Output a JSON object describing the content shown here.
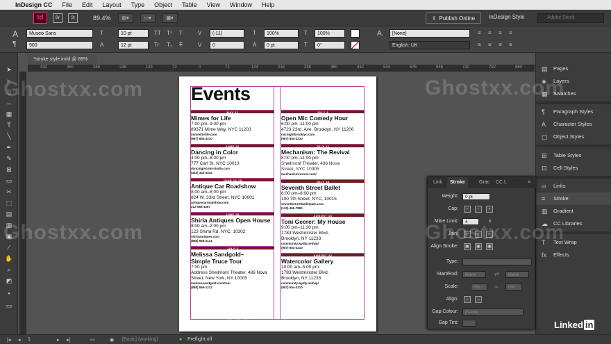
{
  "menubar": {
    "app": "InDesign CC",
    "items": [
      "File",
      "Edit",
      "Layout",
      "Type",
      "Object",
      "Table",
      "View",
      "Window",
      "Help"
    ]
  },
  "appbar": {
    "logo": "Id",
    "bridge": "Br",
    "stock_icon": "St",
    "zoom": "89.4%",
    "publish": "Publish Online",
    "workspace": "InDesign Style",
    "search_placeholder": "Adobe Stock"
  },
  "control": {
    "font_family": "Museo Sans",
    "font_style": "900",
    "font_size": "10 pt",
    "leading": "12 pt",
    "kerning": "(-11)",
    "tracking": "0",
    "vscale": "100%",
    "hscale": "100%",
    "baseline": "0 pt",
    "skew": "0°",
    "char_style": "[None]",
    "language": "English: UK",
    "t_caps": "TT",
    "t_small": "Tr",
    "t_super": "T¹",
    "t_sub": "T₁",
    "t_under": "T",
    "t_strike": "T"
  },
  "doc": {
    "tab": "*stroke style.indd @ 89%"
  },
  "ruler": [
    "432",
    "360",
    "288",
    "216",
    "144",
    "72",
    "0",
    "72",
    "144",
    "216",
    "288",
    "360",
    "432",
    "504",
    "576",
    "648",
    "720",
    "792",
    "864"
  ],
  "page": {
    "title": "Events",
    "left": [
      {
        "date": "MAY 31",
        "title": "Mimes for Life",
        "time": "7:00 pm–9:00 pm",
        "addr": "89371 Mime Way, NYC 11203",
        "url": "mimesforlife.com",
        "phone": "(987) 654-3210"
      },
      {
        "date": "JUNE 20",
        "title": "Dancing in Color",
        "time": "4:00 pm–6:00 pm",
        "addr": "777 Carl St. NYC 10013",
        "url": "dancingincolorstudio.com",
        "phone": "(444) 444-4444"
      },
      {
        "date": "JUNE 24-25",
        "title": "Antique Car Roadshow",
        "time": "8:00 am–6:00 pm",
        "addr": "824 W. 33rd Street, NYC 10001",
        "url": "antiquecarroadshow.com",
        "phone": "212-555-4367"
      },
      {
        "date": "JUNE 28",
        "title": "Shirla Antiques Open House",
        "time": "8:00 am–2:00 pm",
        "addr": "123 Shirla Rd. NYC, 10302",
        "url": "shirlaantiques.com",
        "phone": "(888) 555-2121"
      },
      {
        "date": "JULY 3",
        "title": "Melissa Sandgold–",
        "title2": "Simple Truce Tour",
        "time": "7:00 pm",
        "addr": "Address Shellmont Theater, 486 Nova",
        "addr2": "Street, New York, NY 10005",
        "url": "melissasandgold.com/tour",
        "phone": "(888) 555-1212"
      }
    ],
    "right": [
      {
        "date": "JULY 8",
        "title": "Open Mic Comedy Hour",
        "time": "6:00 pm–11:00 pm",
        "addr": "4723 23rd. Ave, Brooklyn, NY 11206",
        "url": "micnightbrooklyn.com",
        "phone": "(987) 654-3210"
      },
      {
        "date": "JULY 12",
        "title": "Mechanism: The Revival",
        "time": "8:00 pm–11:00 pm",
        "addr": "Shellmont Theater, 486 Nova",
        "addr2": "Street, NYC 10005",
        "url": "mechanismrevival.com/",
        "phone": ""
      },
      {
        "date": "JULY 18",
        "title": "Seventh Street Ballet",
        "time": "6:00 pm–8:00 pm",
        "addr": "100 7th Street, NYC, 10015",
        "url": "seventhstreetballetpark.com",
        "phone": "(123) 456-7890"
      },
      {
        "date": "AUGUST 16",
        "title": "Toni Geerer: My House",
        "time": "9:00 pm–11:30 pm",
        "addr": "1783 Westminster Blvd,",
        "addr2": "Brooklyn, NY 11233",
        "url": "community.wydly.net/wp/",
        "phone": "(987) 654-3210"
      },
      {
        "date": "AUGUST 22",
        "title": "Watercolor Gallery",
        "time": "10:00 am–5:00 pm",
        "addr": "1783 Westminster Blvd,",
        "addr2": "Brooklyn, NY 11233",
        "url": "community.wydly.net/wp/",
        "phone": "(987) 654-3210"
      }
    ]
  },
  "dock": [
    {
      "icon": "▤",
      "label": "Pages"
    },
    {
      "icon": "◈",
      "label": "Layers"
    },
    {
      "icon": "▦",
      "label": "Swatches"
    },
    {
      "icon": "¶",
      "label": "Paragraph Styles"
    },
    {
      "icon": "A",
      "label": "Character Styles"
    },
    {
      "icon": "▢",
      "label": "Object Styles"
    },
    {
      "icon": "⊞",
      "label": "Table Styles"
    },
    {
      "icon": "⊡",
      "label": "Cell Styles"
    },
    {
      "icon": "∞",
      "label": "Links"
    },
    {
      "icon": "≡",
      "label": "Stroke"
    },
    {
      "icon": "▥",
      "label": "Gradient"
    },
    {
      "icon": "☁",
      "label": "CC Libraries"
    },
    {
      "icon": "T",
      "label": "Text Wrap"
    },
    {
      "icon": "fx",
      "label": "Effects"
    }
  ],
  "stroke_panel": {
    "tabs": [
      "Link",
      "Stroke",
      "Grac",
      "CC L"
    ],
    "weight_label": "Weight:",
    "weight": "0 pt",
    "cap_label": "Cap:",
    "mitre_label": "Mitre Limit:",
    "mitre": "4",
    "mitre_unit": "x",
    "join_label": "Join:",
    "align_label": "Align Stroke:",
    "type_label": "Type:",
    "startend_label": "Start/End:",
    "start": "None",
    "end": "None",
    "scale_label": "Scale:",
    "scale1": "0%",
    "scale2": "0%",
    "align2_label": "Align:",
    "gapcolour_label": "Gap Colour:",
    "gapcolour": "[None]",
    "gaptint_label": "Gap Tint:"
  },
  "status": {
    "page": "1",
    "style": "[Basic] (working)",
    "preflight": "Preflight off"
  },
  "watermark": "Ghostxx.com",
  "brand": {
    "name": "Linked",
    "in": "in"
  },
  "colors": {
    "accent": "#6b1d2c",
    "guides": "#c0449e",
    "id_brand": "#ff3366"
  }
}
